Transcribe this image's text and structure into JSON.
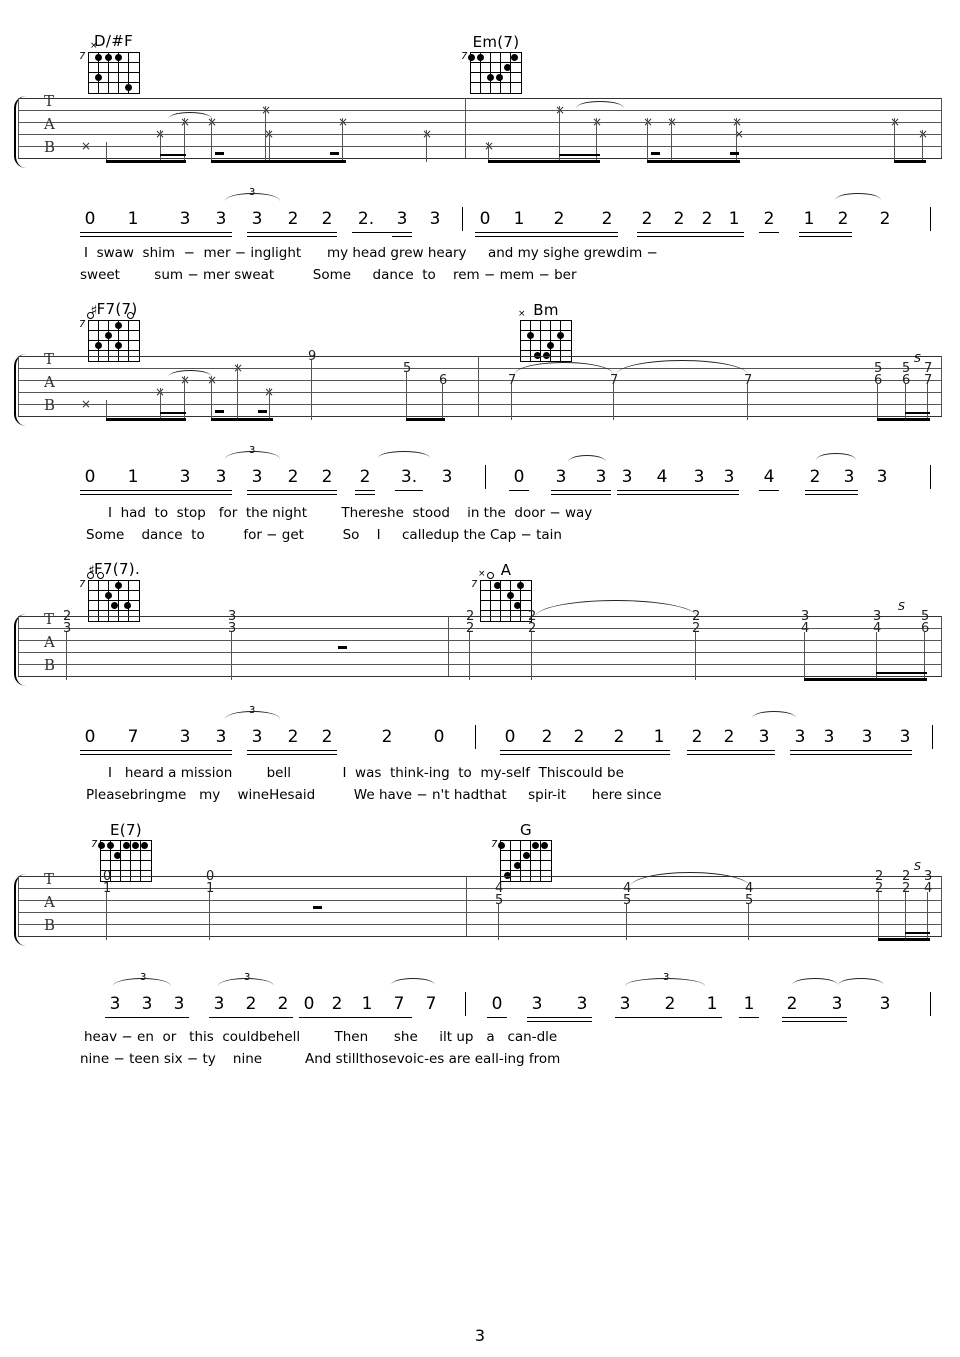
{
  "page": {
    "number": "3"
  },
  "staff": {
    "clef_letters": [
      "T",
      "A",
      "B"
    ]
  },
  "systems": [
    {
      "id": "system-1",
      "chords": [
        {
          "name": "D/#F",
          "sharp": true,
          "base_fret": "7"
        },
        {
          "name": "Em(7)",
          "sharp": false,
          "base_fret": "7"
        }
      ],
      "notation": {
        "measure1": [
          "0",
          "1",
          "3",
          "3",
          "3",
          "2",
          "2",
          "2.",
          "3",
          "3"
        ],
        "measure2": [
          "0",
          "1",
          "2",
          "2",
          "2",
          "2",
          "2",
          "1",
          "2",
          "1",
          "2",
          "2"
        ],
        "triplet_label": "3"
      },
      "lyrics_line1": "I  swaw  shim  −  mer − inglight      my head grew heary     and my sighe grewdim −",
      "lyrics_line2": "sweet        sum − mer sweat         Some     dance  to    rem − mem − ber",
      "tab_numbers": []
    },
    {
      "id": "system-2",
      "chords": [
        {
          "name": "F7(7)",
          "sharp": true,
          "base_fret": "7"
        },
        {
          "name": "Bm",
          "sharp": false,
          "base_fret": ""
        }
      ],
      "notation": {
        "measure1": [
          "0",
          "1",
          "3",
          "3",
          "3",
          "2",
          "2",
          "2",
          "3.",
          "3"
        ],
        "measure2": [
          "0",
          "3",
          "3",
          "3",
          "4",
          "3",
          "3",
          "4",
          "2",
          "3",
          "3"
        ],
        "triplet_label": "3"
      },
      "lyrics_line1": "I  had  to  stop   for  the night        Thereshe  stood    in the  door − way",
      "lyrics_line2": "Some    dance  to         for − get         So    I     calledup the Cap − tain",
      "tab_numbers": [
        "9",
        "5",
        "6",
        "7",
        "7",
        "7",
        "5",
        "6",
        "5",
        "6",
        "7",
        "7"
      ],
      "slide_label": "S"
    },
    {
      "id": "system-3",
      "chords": [
        {
          "name": "F7(7).",
          "sharp": true,
          "base_fret": "7"
        },
        {
          "name": "A",
          "sharp": false,
          "base_fret": "7"
        }
      ],
      "notation": {
        "measure1": [
          "0",
          "7",
          "3",
          "3",
          "3",
          "2",
          "2",
          "2",
          "0"
        ],
        "measure2": [
          "0",
          "2",
          "2",
          "2",
          "1",
          "2",
          "2",
          "3",
          "3",
          "3",
          "3",
          "3"
        ],
        "triplet_label": "3"
      },
      "lyrics_line1": "I   heard a mission        bell            I  was  think-ing  to  my-self  Thiscould be",
      "lyrics_line2": "Pleasebringme   my    wineHesaid         We have − n't hadthat     spir-it      here since",
      "tab_numbers": [
        "2",
        "3",
        "3",
        "3",
        "2",
        "2",
        "2",
        "2",
        "2",
        "2",
        "3",
        "4",
        "3",
        "4",
        "5",
        "6"
      ],
      "slide_label": "S"
    },
    {
      "id": "system-4",
      "chords": [
        {
          "name": "E(7)",
          "sharp": false,
          "base_fret": "7"
        },
        {
          "name": "G",
          "sharp": false,
          "base_fret": "7"
        }
      ],
      "notation": {
        "measure1": [
          "3",
          "3",
          "3",
          "3",
          "2",
          "2",
          "0",
          "2",
          "1",
          "7",
          "7"
        ],
        "measure2": [
          "0",
          "3",
          "3",
          "3",
          "2",
          "1",
          "1",
          "2",
          "3",
          "3"
        ],
        "triplet_label": "3"
      },
      "lyrics_line1": "heav − en  or   this  couldbehell        Then      she     ilt up   a   can-dle",
      "lyrics_line2": "nine − teen six − ty    nine          And stillthosevoic-es are eall-ing from",
      "tab_numbers": [
        "0",
        "1",
        "0",
        "1",
        "4",
        "5",
        "4",
        "5",
        "4",
        "5",
        "2",
        "2",
        "2",
        "2",
        "3",
        "4"
      ],
      "slide_label": "S"
    }
  ]
}
